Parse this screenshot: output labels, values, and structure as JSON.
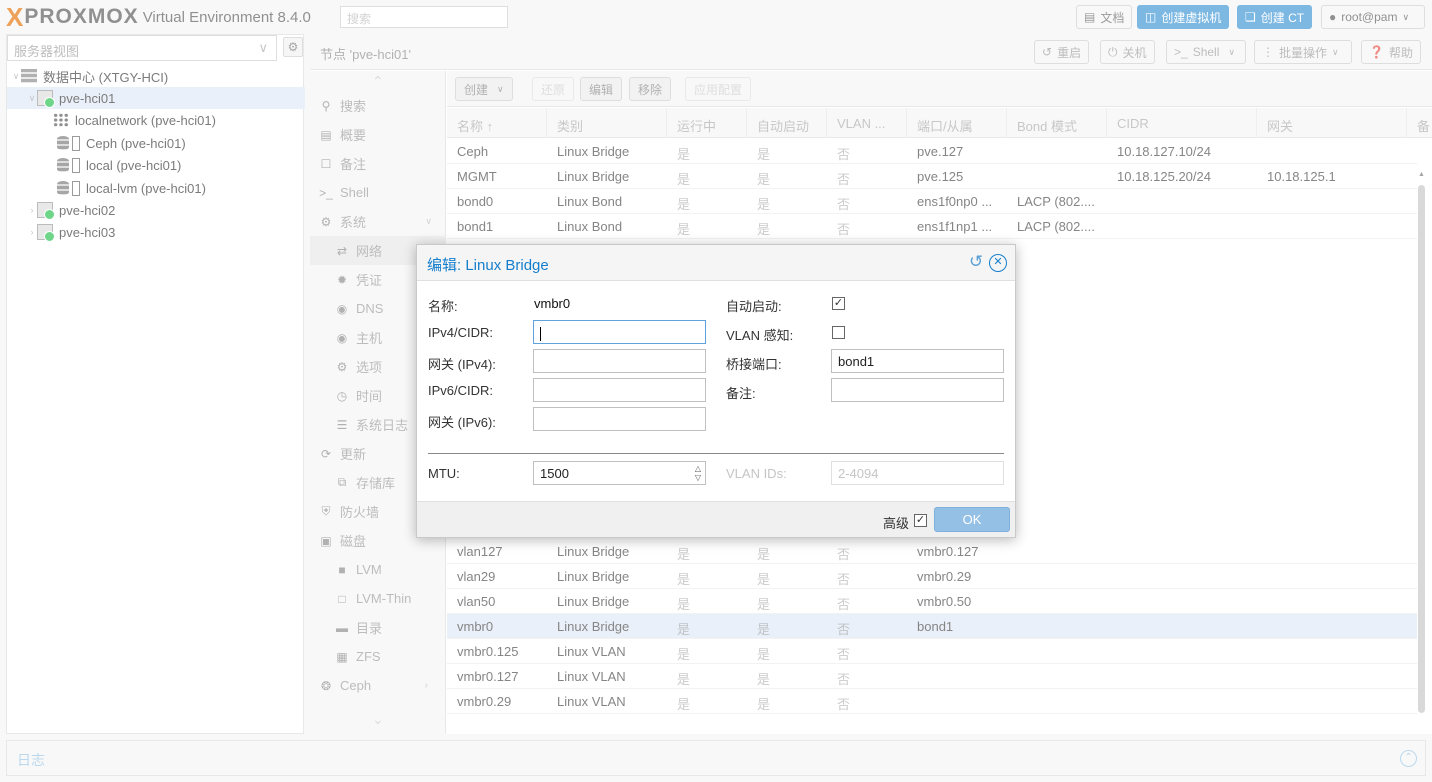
{
  "topbar": {
    "logo_x": "X",
    "logo_text": "PROXMOX",
    "version": "Virtual Environment 8.4.0",
    "search_placeholder": "搜索",
    "docs": "文档",
    "create_vm": "创建虚拟机",
    "create_ct": "创建 CT",
    "user": "root@pam"
  },
  "tree": {
    "view": "服务器视图",
    "datacenter": "数据中心 (XTGY-HCI)",
    "nodes": [
      "pve-hci01",
      "pve-hci02",
      "pve-hci03"
    ],
    "storages": [
      "localnetwork (pve-hci01)",
      "Ceph (pve-hci01)",
      "local (pve-hci01)",
      "local-lvm (pve-hci01)"
    ]
  },
  "header": {
    "title": "节点 'pve-hci01'",
    "reboot": "重启",
    "shutdown": "关机",
    "shell": "Shell",
    "bulk": "批量操作",
    "help": "帮助"
  },
  "nav": [
    {
      "label": "搜索",
      "icon": "search-icon"
    },
    {
      "label": "概要",
      "icon": "book-icon"
    },
    {
      "label": "备注",
      "icon": "note-icon"
    },
    {
      "label": "Shell",
      "icon": "terminal-icon"
    },
    {
      "label": "系统",
      "icon": "cogs-icon"
    },
    {
      "label": "网络",
      "icon": "exchange-icon"
    },
    {
      "label": "凭证",
      "icon": "certificate-icon"
    },
    {
      "label": "DNS",
      "icon": "globe-icon"
    },
    {
      "label": "主机",
      "icon": "globe-icon"
    },
    {
      "label": "选项",
      "icon": "gear-icon"
    },
    {
      "label": "时间",
      "icon": "clock-icon"
    },
    {
      "label": "系统日志",
      "icon": "list-icon"
    },
    {
      "label": "更新",
      "icon": "refresh-icon"
    },
    {
      "label": "存储库",
      "icon": "files-icon"
    },
    {
      "label": "防火墙",
      "icon": "shield-icon"
    },
    {
      "label": "磁盘",
      "icon": "hdd-icon"
    },
    {
      "label": "LVM",
      "icon": "square-icon"
    },
    {
      "label": "LVM-Thin",
      "icon": "square-outline-icon"
    },
    {
      "label": "目录",
      "icon": "folder-icon"
    },
    {
      "label": "ZFS",
      "icon": "grid-icon"
    },
    {
      "label": "Ceph",
      "icon": "ceph-icon"
    }
  ],
  "grid": {
    "toolbar": {
      "create": "创建",
      "revert": "还原",
      "edit": "编辑",
      "remove": "移除",
      "apply": "应用配置"
    },
    "columns": [
      "名称 ↑",
      "类别",
      "运行中",
      "自动启动",
      "VLAN ...",
      "端口/从属",
      "Bond 模式",
      "CIDR",
      "网关",
      "备"
    ],
    "rows_top": [
      [
        "Ceph",
        "Linux Bridge",
        "是",
        "是",
        "否",
        "pve.127",
        "",
        "10.18.127.10/24",
        ""
      ],
      [
        "MGMT",
        "Linux Bridge",
        "是",
        "是",
        "否",
        "pve.125",
        "",
        "10.18.125.20/24",
        "10.18.125.1"
      ],
      [
        "bond0",
        "Linux Bond",
        "是",
        "是",
        "否",
        "ens1f0np0 ...",
        "LACP (802....",
        "",
        ""
      ],
      [
        "bond1",
        "Linux Bond",
        "是",
        "是",
        "否",
        "ens1f1np1 ...",
        "LACP (802....",
        "",
        ""
      ]
    ],
    "rows_bottom": [
      [
        "vlan127",
        "Linux Bridge",
        "是",
        "是",
        "否",
        "vmbr0.127",
        "",
        "",
        ""
      ],
      [
        "vlan29",
        "Linux Bridge",
        "是",
        "是",
        "否",
        "vmbr0.29",
        "",
        "",
        ""
      ],
      [
        "vlan50",
        "Linux Bridge",
        "是",
        "是",
        "否",
        "vmbr0.50",
        "",
        "",
        ""
      ],
      [
        "vmbr0",
        "Linux Bridge",
        "是",
        "是",
        "否",
        "bond1",
        "",
        "",
        ""
      ],
      [
        "vmbr0.125",
        "Linux VLAN",
        "是",
        "是",
        "否",
        "",
        "",
        "",
        ""
      ],
      [
        "vmbr0.127",
        "Linux VLAN",
        "是",
        "是",
        "否",
        "",
        "",
        "",
        ""
      ],
      [
        "vmbr0.29",
        "Linux VLAN",
        "是",
        "是",
        "否",
        "",
        "",
        "",
        ""
      ]
    ]
  },
  "dialog": {
    "title": "编辑: Linux Bridge",
    "name_label": "名称:",
    "name_value": "vmbr0",
    "ipv4_label": "IPv4/CIDR:",
    "ipv4_value": "",
    "gw4_label": "网关 (IPv4):",
    "gw4_value": "",
    "ipv6_label": "IPv6/CIDR:",
    "ipv6_value": "",
    "gw6_label": "网关 (IPv6):",
    "gw6_value": "",
    "autostart_label": "自动启动:",
    "autostart_checked": true,
    "vlan_aware_label": "VLAN 感知:",
    "vlan_aware_checked": false,
    "ports_label": "桥接端口:",
    "ports_value": "bond1",
    "comment_label": "备注:",
    "comment_value": "",
    "mtu_label": "MTU:",
    "mtu_value": "1500",
    "vlan_ids_label": "VLAN IDs:",
    "vlan_ids_placeholder": "2-4094",
    "advanced_label": "高级",
    "advanced_checked": true,
    "ok": "OK"
  },
  "log": {
    "title": "日志"
  }
}
